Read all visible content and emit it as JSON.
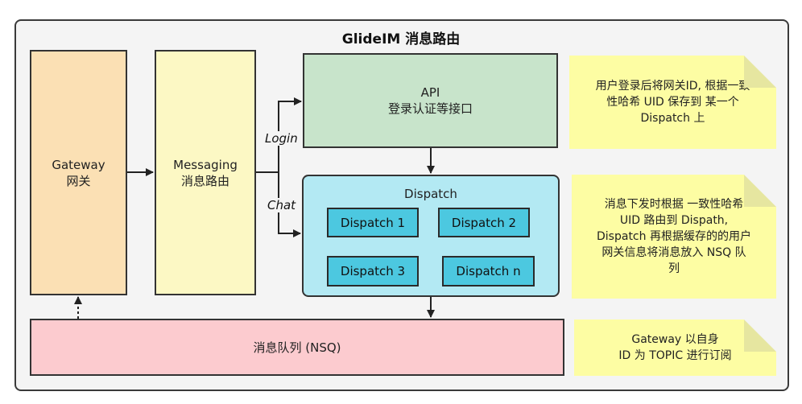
{
  "title": "GlideIM 消息路由",
  "gateway": {
    "line1": "Gateway",
    "line2": "网关"
  },
  "messaging": {
    "line1": "Messaging",
    "line2": "消息路由"
  },
  "api": {
    "line1": "API",
    "line2": "登录认证等接口"
  },
  "dispatch": {
    "label": "Dispatch",
    "nodes": [
      "Dispatch 1",
      "Dispatch 2",
      "Dispatch 3",
      "Dispatch n"
    ]
  },
  "nsq": {
    "label": "消息队列 (NSQ)"
  },
  "edges": {
    "login": "Login",
    "chat": "Chat"
  },
  "notes": [
    [
      "用户登录后将网关ID, 根据一致",
      "性哈希 UID 保存到 某一个",
      "Dispatch 上"
    ],
    [
      "消息下发时根据 一致性哈希",
      "UID 路由到 Dispath,",
      "Dispatch 再根据缓存的的用户",
      "网关信息将消息放入 NSQ 队",
      "列"
    ],
    [
      "Gateway 以自身",
      "ID 为 TOPIC 进行订阅"
    ]
  ]
}
